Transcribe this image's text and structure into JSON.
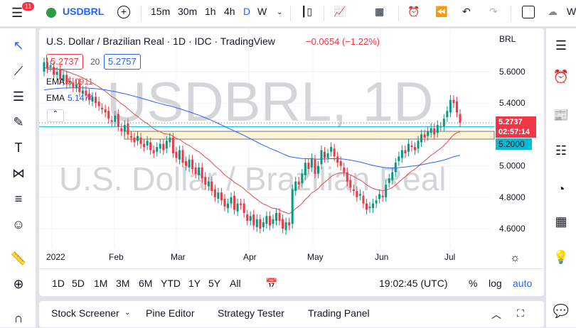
{
  "top": {
    "notif": "11",
    "symbol": "USDBRL",
    "intervals": [
      "15m",
      "30m",
      "1h",
      "4h",
      "D",
      "W"
    ],
    "partial": "W"
  },
  "legend": {
    "title": "U.S. Dollar / Brazilian Real · 1D · IDC · TradingView",
    "change": "−0.0654 (−1.22%)",
    "bid": "5.2737",
    "spread": "20",
    "ask": "5.2757",
    "ema1_label": "EMA",
    "ema1": "5.0911",
    "ema2_label": "EMA",
    "ema2": "5.1474",
    "currency": "BRL"
  },
  "watermark": {
    "symbol": "USDBRL, 1D",
    "name": "U.S. Dollar / Brazilian Real"
  },
  "colors": {
    "up": "#089981",
    "down": "#f23645",
    "ema_fast": "#e5484d",
    "ema_slow": "#2962ff",
    "zone": "#fff3d6",
    "support": "#00bcd4"
  },
  "chart_data": {
    "type": "candlestick",
    "price_ticks": [
      "5.6000",
      "5.4000",
      "5.2000",
      "5.0000",
      "4.8000",
      "4.6000"
    ],
    "tick_values": [
      5.6,
      5.4,
      5.2,
      5.0,
      4.8,
      4.6
    ],
    "time_labels": [
      "2022",
      "Feb",
      "Mar",
      "Apr",
      "May",
      "Jun",
      "Jul"
    ],
    "closes": [
      5.66,
      5.62,
      5.64,
      5.58,
      5.6,
      5.55,
      5.58,
      5.52,
      5.54,
      5.5,
      5.52,
      5.47,
      5.48,
      5.45,
      5.42,
      5.44,
      5.4,
      5.38,
      5.36,
      5.34,
      5.3,
      5.28,
      5.32,
      5.25,
      5.22,
      5.26,
      5.2,
      5.18,
      5.15,
      5.19,
      5.14,
      5.12,
      5.16,
      5.1,
      5.08,
      5.12,
      5.14,
      5.1,
      5.16,
      5.18,
      5.08,
      5.05,
      5.1,
      5.02,
      5.0,
      5.04,
      4.98,
      4.95,
      4.99,
      4.92,
      4.88,
      4.9,
      4.84,
      4.8,
      4.83,
      4.78,
      4.74,
      4.76,
      4.8,
      4.72,
      4.76,
      4.75,
      4.7,
      4.65,
      4.68,
      4.62,
      4.66,
      4.6,
      4.64,
      4.68,
      4.62,
      4.66,
      4.7,
      4.65,
      4.6,
      4.64,
      4.62,
      4.85,
      4.9,
      4.88,
      4.95,
      5.02,
      4.98,
      5.05,
      4.95,
      5.0,
      5.1,
      5.05,
      5.08,
      5.12,
      5.06,
      5.02,
      5.0,
      4.96,
      4.9,
      4.86,
      4.84,
      4.8,
      4.82,
      4.76,
      4.72,
      4.74,
      4.76,
      4.78,
      4.82,
      4.8,
      4.88,
      4.92,
      4.96,
      5.02,
      5.06,
      5.1,
      5.08,
      5.14,
      5.12,
      5.1,
      5.16,
      5.2,
      5.18,
      5.22,
      5.24,
      5.2,
      5.26,
      5.25,
      5.3,
      5.35,
      5.42,
      5.4,
      5.34,
      5.2737
    ],
    "last_price": "5.2737",
    "countdown": "02:57:14",
    "support_price": "5.2000",
    "support_value": 5.2
  },
  "timeframes": [
    "1D",
    "5D",
    "1M",
    "3M",
    "6M",
    "YTD",
    "1Y",
    "5Y",
    "All"
  ],
  "clock": "19:02:45 (UTC)",
  "scale": {
    "pct": "%",
    "log": "log",
    "auto": "auto"
  },
  "bottom": {
    "tabs": [
      "Stock Screener",
      "Pine Editor",
      "Strategy Tester",
      "Trading Panel"
    ]
  }
}
